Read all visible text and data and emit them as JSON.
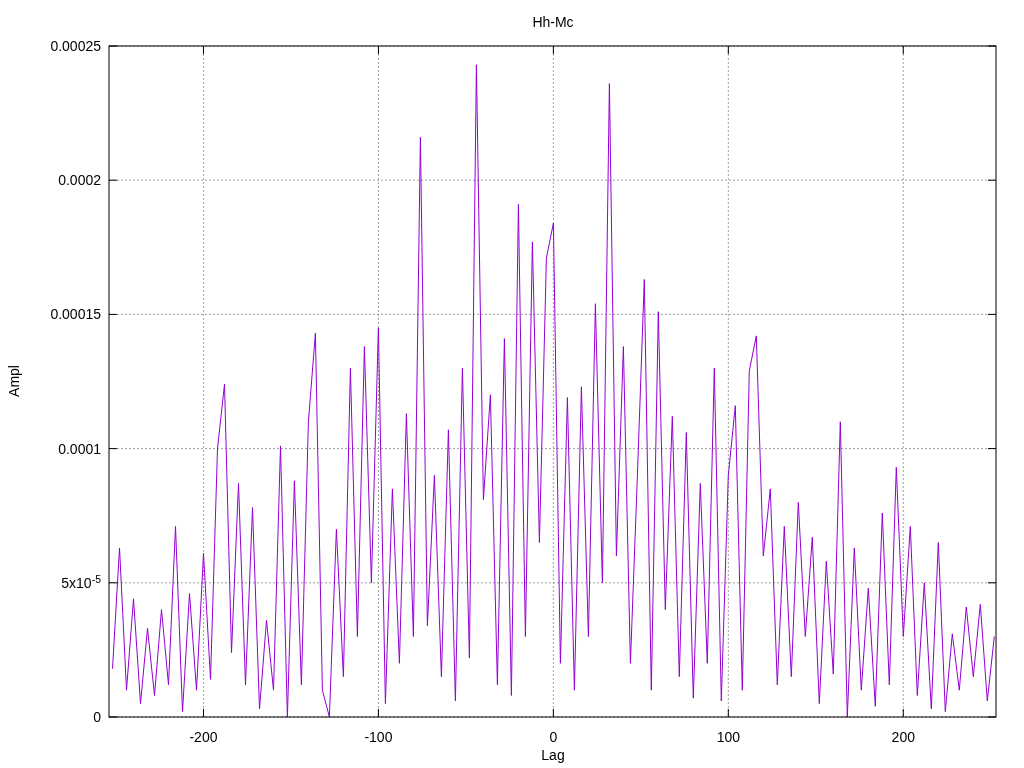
{
  "chart_data": {
    "type": "line",
    "title": "Hh-Mc",
    "xlabel": "Lag",
    "ylabel": "Ampl",
    "grid": true,
    "xlim": [
      -254,
      253
    ],
    "ylim": [
      0,
      0.00025
    ],
    "xticks": [
      -200,
      -100,
      0,
      100,
      200
    ],
    "yticks": [
      {
        "value": 0,
        "label": "0"
      },
      {
        "value": 5e-05,
        "label": "5x10$^{-5}$"
      },
      {
        "value": 0.0001,
        "label": "0.0001"
      },
      {
        "value": 0.00015,
        "label": "0.00015"
      },
      {
        "value": 0.0002,
        "label": "0.0002"
      },
      {
        "value": 0.00025,
        "label": "0.00025"
      }
    ],
    "x": [
      -252,
      -248,
      -244,
      -240,
      -236,
      -232,
      -228,
      -224,
      -220,
      -216,
      -212,
      -208,
      -204,
      -200,
      -196,
      -192,
      -188,
      -184,
      -180,
      -176,
      -172,
      -168,
      -164,
      -160,
      -156,
      -152,
      -148,
      -144,
      -140,
      -136,
      -132,
      -128,
      -124,
      -120,
      -116,
      -112,
      -108,
      -104,
      -100,
      -96,
      -92,
      -88,
      -84,
      -80,
      -76,
      -72,
      -68,
      -64,
      -60,
      -56,
      -52,
      -48,
      -44,
      -40,
      -36,
      -32,
      -28,
      -24,
      -20,
      -16,
      -12,
      -8,
      -4,
      0,
      4,
      8,
      12,
      16,
      20,
      24,
      28,
      32,
      36,
      40,
      44,
      48,
      52,
      56,
      60,
      64,
      68,
      72,
      76,
      80,
      84,
      88,
      92,
      96,
      100,
      104,
      108,
      112,
      116,
      120,
      124,
      128,
      132,
      136,
      140,
      144,
      148,
      152,
      156,
      160,
      164,
      168,
      172,
      176,
      180,
      184,
      188,
      192,
      196,
      200,
      204,
      208,
      212,
      216,
      220,
      224,
      228,
      232,
      236,
      240,
      244,
      248,
      252
    ],
    "series": [
      {
        "color": "#9400d3",
        "values": [
          1.8e-05,
          6.3e-05,
          1e-05,
          4.4e-05,
          5e-06,
          3.3e-05,
          8e-06,
          4e-05,
          1.2e-05,
          7.1e-05,
          2e-06,
          4.6e-05,
          1e-05,
          6.1e-05,
          1.4e-05,
          0.0001,
          0.000124,
          2.4e-05,
          8.7e-05,
          1.2e-05,
          7.8e-05,
          3e-06,
          3.6e-05,
          1e-05,
          0.000101,
          0,
          8.8e-05,
          1.2e-05,
          0.00011,
          0.000143,
          1e-05,
          0,
          7e-05,
          1.5e-05,
          0.00013,
          3e-05,
          0.000138,
          5e-05,
          0.000145,
          5e-06,
          8.5e-05,
          2e-05,
          0.000113,
          3e-05,
          0.000216,
          3.4e-05,
          9e-05,
          1.5e-05,
          0.000107,
          6e-06,
          0.00013,
          2.2e-05,
          0.000243,
          8.1e-05,
          0.00012,
          1.2e-05,
          0.000141,
          8e-06,
          0.000191,
          3e-05,
          0.000177,
          6.5e-05,
          0.000171,
          0.000184,
          2e-05,
          0.000119,
          1e-05,
          0.000123,
          3e-05,
          0.000154,
          5e-05,
          0.000236,
          6e-05,
          0.000138,
          2e-05,
          9e-05,
          0.000163,
          1e-05,
          0.000151,
          4e-05,
          0.000112,
          1.5e-05,
          0.000106,
          7e-06,
          8.7e-05,
          2e-05,
          0.00013,
          6e-06,
          9e-05,
          0.000116,
          1e-05,
          0.000129,
          0.000142,
          6e-05,
          8.5e-05,
          1.2e-05,
          7.1e-05,
          1.5e-05,
          8e-05,
          3e-05,
          6.7e-05,
          5e-06,
          5.8e-05,
          1.6e-05,
          0.00011,
          0,
          6.3e-05,
          1e-05,
          4.8e-05,
          4e-06,
          7.6e-05,
          1.2e-05,
          9.3e-05,
          3e-05,
          7.1e-05,
          8e-06,
          5e-05,
          3e-06,
          6.5e-05,
          2e-06,
          3.1e-05,
          1e-05,
          4.1e-05,
          1.5e-05,
          4.2e-05,
          6e-06,
          3e-05
        ]
      }
    ]
  }
}
